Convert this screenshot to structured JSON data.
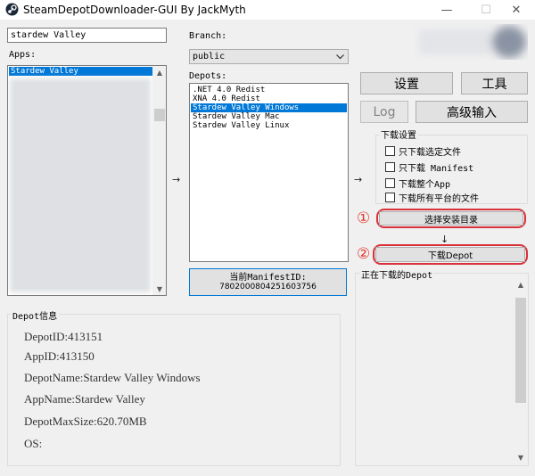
{
  "window": {
    "title": "SteamDepotDownloader-GUI By JackMyth",
    "minimize_glyph": "—",
    "maximize_glyph": "☐",
    "close_glyph": "✕"
  },
  "search": {
    "value": "stardew Valley"
  },
  "apps": {
    "label": "Apps:",
    "items": [
      "Stardew Valley"
    ]
  },
  "branch": {
    "label": "Branch:",
    "value": "public"
  },
  "depots": {
    "label": "Depots:",
    "items": [
      ".NET 4.0 Redist",
      "XNA 4.0 Redist",
      "Stardew Valley Windows",
      "Stardew Valley Mac",
      "Stardew Valley Linux"
    ],
    "selected_index": 2
  },
  "manifest": {
    "line1": "当前ManifestID:",
    "line2": "7802000804251603756"
  },
  "arrows": {
    "right": "→",
    "down": "↓"
  },
  "toolbar": {
    "settings_label": "设置",
    "tools_label": "工具",
    "log_label": "Log",
    "advanced_input_label": "高级输入"
  },
  "download_settings": {
    "title": "下载设置",
    "options": [
      "只下载选定文件",
      "只下载 Manifest",
      "下载整个App",
      "下载所有平台的文件"
    ]
  },
  "steps": {
    "one": "①",
    "two": "②"
  },
  "actions": {
    "choose_dir_label": "选择安装目录",
    "download_label": "下载Depot"
  },
  "downloading": {
    "title": "正在下载的Depot"
  },
  "depot_info": {
    "title": "Depot信息",
    "depot_id": "DepotID:413151",
    "app_id": "AppID:413150",
    "depot_name": "DepotName:Stardew Valley Windows",
    "app_name": "AppName:Stardew Valley",
    "max_size": "DepotMaxSize:620.70MB",
    "os": "OS:"
  },
  "colors": {
    "selection": "#0078d7",
    "highlight_ring": "#d9303a",
    "window_bg": "#f0f0f0"
  }
}
